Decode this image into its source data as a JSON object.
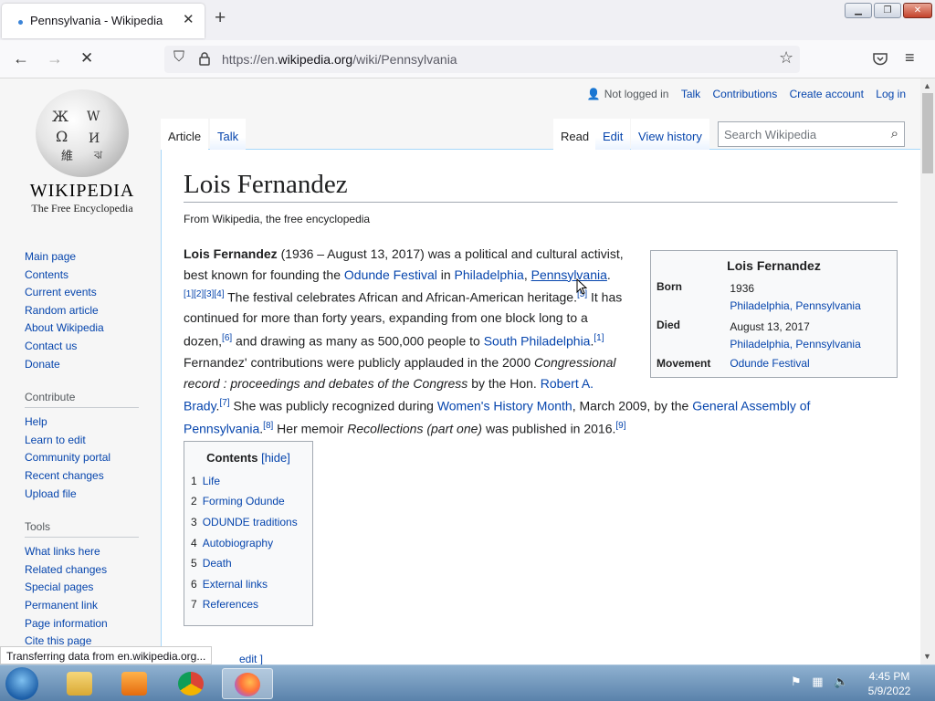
{
  "browser": {
    "tab_title": "Pennsylvania - Wikipedia",
    "tab_close": "✕",
    "new_tab": "+",
    "url_prefix": "https://en.",
    "url_domain": "wikipedia.org",
    "url_path": "/wiki/Pennsylvania",
    "status_text": "Transferring data from en.wikipedia.org..."
  },
  "wiki": {
    "wordmark": "WIKIPEDIA",
    "tagline": "The Free Encyclopedia",
    "personal": {
      "not_logged_in": "Not logged in",
      "talk": "Talk",
      "contributions": "Contributions",
      "create_account": "Create account",
      "log_in": "Log in"
    },
    "tabs": {
      "article": "Article",
      "talk": "Talk",
      "read": "Read",
      "edit": "Edit",
      "history": "View history"
    },
    "search_placeholder": "Search Wikipedia",
    "nav": [
      "Main page",
      "Contents",
      "Current events",
      "Random article",
      "About Wikipedia",
      "Contact us",
      "Donate"
    ],
    "contribute_heading": "Contribute",
    "contribute": [
      "Help",
      "Learn to edit",
      "Community portal",
      "Recent changes",
      "Upload file"
    ],
    "tools_heading": "Tools",
    "tools": [
      "What links here",
      "Related changes",
      "Special pages",
      "Permanent link",
      "Page information",
      "Cite this page"
    ]
  },
  "article": {
    "title": "Lois Fernandez",
    "from": "From Wikipedia, the free encyclopedia",
    "p1": {
      "name": "Lois Fernandez",
      "t1": " (1936 – August 13, 2017) was a political and cultural activist,",
      "t2": "best known for founding the ",
      "link_odunde": "Odunde Festival",
      "t3": " in ",
      "link_philly": "Philadelphia",
      "comma": ", ",
      "link_pa": "Pennsylvania",
      "period": ".",
      "refs1": "[1][2][3][4]",
      "t4": " The festival celebrates African and African-American heritage.",
      "ref5": "[5]",
      "t5": " It has",
      "t6": "continued for more than forty years, expanding from one block long to a",
      "t7": "dozen,",
      "ref6": "[6]",
      "t8": " and drawing as many as 500,000 people to ",
      "link_south": "South Philadelphia",
      "t9": ".",
      "ref1": "[1]"
    },
    "p2": {
      "t1": "Fernandez' contributions were publicly applauded in the 2000 ",
      "i1": "Congressional",
      "i2": "record : proceedings and debates of the Congress",
      "t2": " by the Hon. ",
      "link_brady1": "Robert A.",
      "link_brady2": "Brady",
      "t3": ".",
      "ref7": "[7]",
      "t4": " She was publicly recognized during ",
      "link_whm": "Women's History Month",
      "t5": ", March 2009, by the ",
      "link_ga1": "General Assembly of",
      "link_ga2": "Pennsylvania",
      "t6": ".",
      "ref8": "[8]",
      "t7": " Her memoir ",
      "i3": "Recollections (part one)",
      "t8": " was published in 2016.",
      "ref9": "[9]"
    },
    "infobox": {
      "title": "Lois Fernandez",
      "born_label": "Born",
      "born_year": "1936",
      "born_place": "Philadelphia, Pennsylvania",
      "died_label": "Died",
      "died_date": "August 13, 2017",
      "died_place": "Philadelphia, Pennsylvania",
      "movement_label": "Movement",
      "movement": "Odunde Festival"
    },
    "toc": {
      "title": "Contents",
      "hide": "[hide]",
      "items": [
        {
          "num": "1",
          "label": "Life"
        },
        {
          "num": "2",
          "label": "Forming Odunde"
        },
        {
          "num": "3",
          "label": "ODUNDE traditions"
        },
        {
          "num": "4",
          "label": "Autobiography"
        },
        {
          "num": "5",
          "label": "Death"
        },
        {
          "num": "6",
          "label": "External links"
        },
        {
          "num": "7",
          "label": "References"
        }
      ]
    },
    "edit_fragment": "edit ]"
  },
  "taskbar": {
    "time": "4:45 PM",
    "date": "5/9/2022"
  }
}
